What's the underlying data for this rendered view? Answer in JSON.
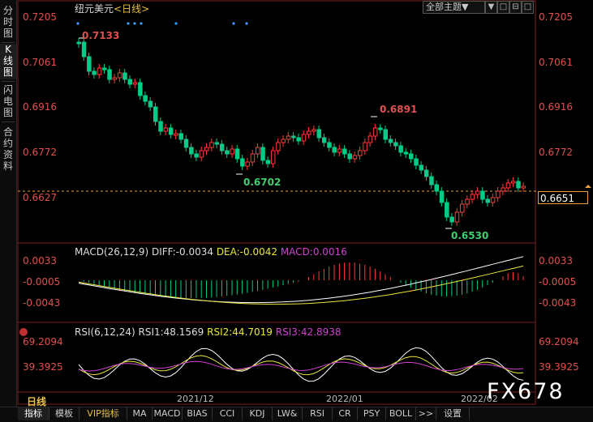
{
  "sidebar": {
    "tabs": [
      {
        "label": "分\n时\n图"
      },
      {
        "label": "K\n线\n图"
      },
      {
        "label": "闪\n电\n图"
      },
      {
        "label": "合\n约\n资\n料"
      }
    ]
  },
  "header": {
    "title": "纽元美元",
    "period_tag": "<日线>",
    "theme_select": "全部主题▼",
    "buttons": [
      "▼",
      "□",
      "⊟",
      "□"
    ]
  },
  "price_axis": {
    "levels": [
      "0.7205",
      "0.7061",
      "0.6916",
      "0.6772",
      "0.6627"
    ],
    "current": "0.6651"
  },
  "annotations": {
    "high": "0.7133",
    "mid_high": "0.6891",
    "low1": "0.6702",
    "low2": "0.6530"
  },
  "macd": {
    "title": "MACD(26,12,9)",
    "diff": "DIFF:-0.0034",
    "dea": "DEA:-0.0042",
    "macd": "MACD:0.0016",
    "levels": [
      "0.0033",
      "-0.0005",
      "-0.0043"
    ]
  },
  "rsi": {
    "title": "RSI(6,12,24)",
    "rsi1": "RSI1:48.1569",
    "rsi2": "RSI2:44.7019",
    "rsi3": "RSI3:42.8938",
    "levels": [
      "69.2094",
      "39.3925"
    ]
  },
  "x_axis": {
    "period": "日线",
    "dates": [
      "2021/12",
      "2022/01",
      "2022/02"
    ]
  },
  "bottom_tabs": [
    "指标",
    "模板",
    "VIP指标",
    "MA",
    "MACD",
    "BIAS",
    "CCI",
    "KDJ",
    "LW&",
    "RSI",
    "CR",
    "PSY",
    "BOLL",
    ">>",
    "设置"
  ],
  "watermark": "FX678",
  "colors": {
    "up": "#ff3a3a",
    "down": "#00cc88",
    "label_red": "#e05050",
    "label_green": "#40d070",
    "dea": "#e8e840",
    "macd_text": "#d040d0"
  }
}
